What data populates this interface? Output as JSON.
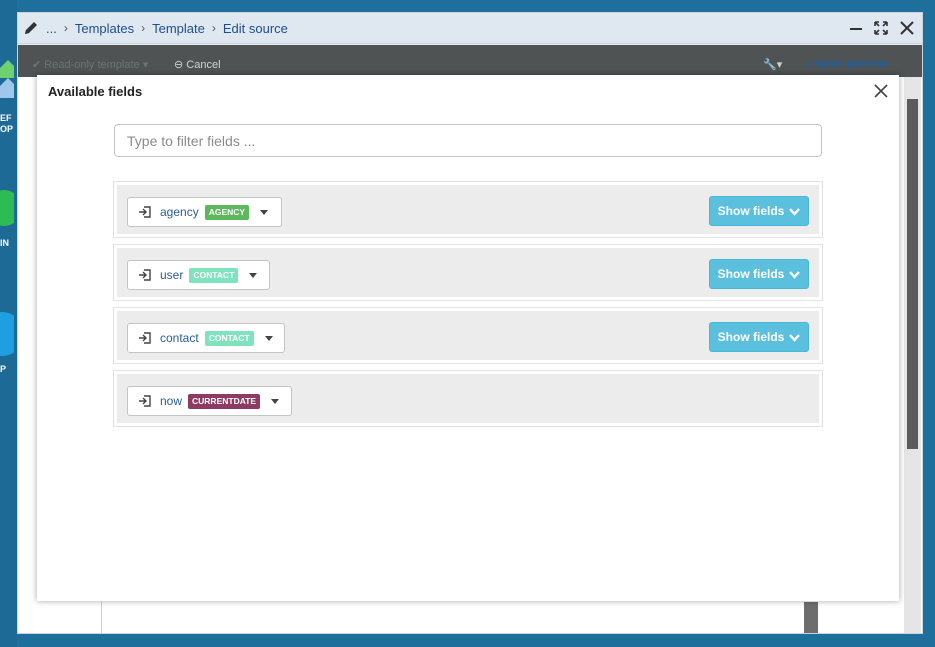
{
  "breadcrumb": {
    "items": [
      "...",
      "Templates",
      "Template",
      "Edit source"
    ]
  },
  "toolbar": {
    "readonly_label": "Read-only template",
    "cancel_label": "Cancel",
    "open_preview_label": "Open preview"
  },
  "desktop": {
    "labels": [
      "EF",
      "OP",
      "IN",
      "P"
    ]
  },
  "modal": {
    "title": "Available fields",
    "filter_placeholder": "Type to filter fields ...",
    "fields": [
      {
        "name": "agency",
        "badge": "AGENCY",
        "badge_color": "#5cb85c",
        "show_fields_label": "Show fields"
      },
      {
        "name": "user",
        "badge": "CONTACT",
        "badge_color": "#7fe3bd",
        "show_fields_label": "Show fields"
      },
      {
        "name": "contact",
        "badge": "CONTACT",
        "badge_color": "#7fe3bd",
        "show_fields_label": "Show fields"
      },
      {
        "name": "now",
        "badge": "CURRENTDATE",
        "badge_color": "#8e3b63"
      }
    ]
  },
  "colors": {
    "accent": "#5bc0de",
    "link": "#2a5d99",
    "titlebar": "#dfe8f1"
  }
}
